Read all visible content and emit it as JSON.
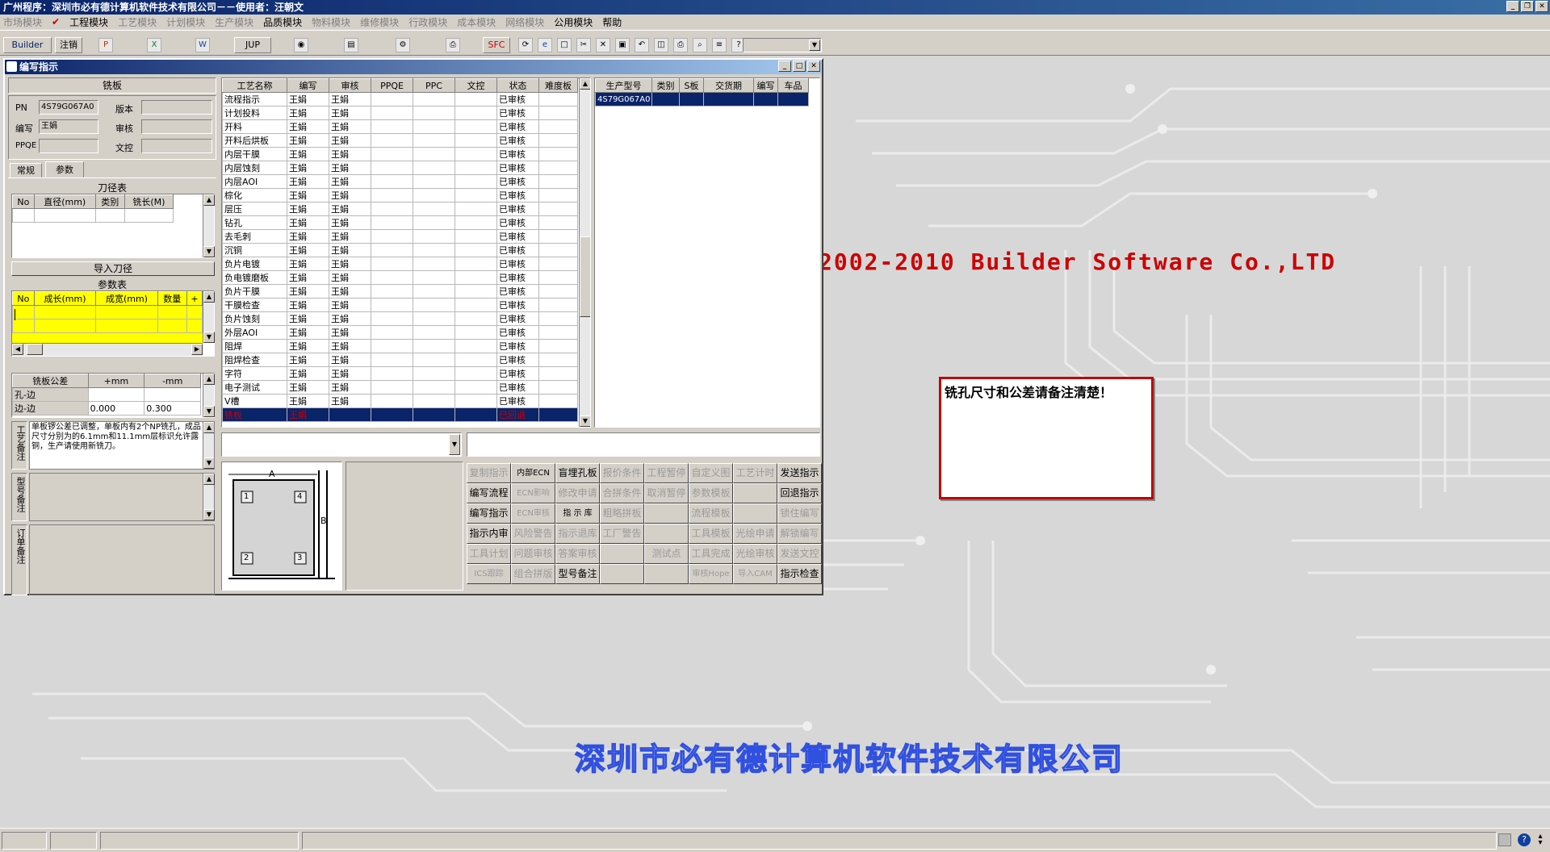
{
  "app": {
    "title": "广州程序：深圳市必有德计算机软件技术有限公司－－使用者：汪朝文"
  },
  "menu": [
    {
      "label": "市场模块",
      "on": false
    },
    {
      "label": "工程模块",
      "on": true
    },
    {
      "label": "工艺模块",
      "on": false
    },
    {
      "label": "计划模块",
      "on": false
    },
    {
      "label": "生产模块",
      "on": false
    },
    {
      "label": "品质模块",
      "on": true
    },
    {
      "label": "物料模块",
      "on": false
    },
    {
      "label": "维修模块",
      "on": false
    },
    {
      "label": "行政模块",
      "on": false
    },
    {
      "label": "成本模块",
      "on": false
    },
    {
      "label": "网络模块",
      "on": false
    },
    {
      "label": "公用模块",
      "on": true
    },
    {
      "label": "帮助",
      "on": true
    }
  ],
  "toolbar": {
    "builder": "Builder",
    "logout": "注销",
    "jup": "JUP",
    "spc": "SFC"
  },
  "window": {
    "title": "编写指示"
  },
  "form": {
    "header": "铣板",
    "pn_label": "PN",
    "pn_value": "4S79G067A0",
    "version_label": "版本",
    "version_value": "",
    "writer_label": "编写",
    "writer_value": "王娟",
    "audit_label": "审核",
    "audit_value": "",
    "ppqe_label": "PPQE",
    "ppqe_value": "",
    "wenkong_label": "文控",
    "wenkong_value": ""
  },
  "tabs": {
    "general": "常规",
    "params": "参数"
  },
  "tool_table": {
    "title": "刀径表",
    "headers": [
      "No",
      "直径(mm)",
      "类别",
      "铣长(M)"
    ],
    "import_button": "导入刀径"
  },
  "param_table": {
    "title": "参数表",
    "headers": [
      "No",
      "成长(mm)",
      "成宽(mm)",
      "数量",
      "+"
    ]
  },
  "tolerance": {
    "headers": [
      "铣板公差",
      "+mm",
      "-mm"
    ],
    "rows": [
      {
        "label": "孔-边",
        "plus": "",
        "minus": ""
      },
      {
        "label": "边-边",
        "plus": "0.000",
        "minus": "0.300"
      }
    ]
  },
  "notes": {
    "process_label": "工艺备注",
    "process_text": "单板锣公差已调整，单板内有2个NP铣孔，成品尺寸分别为的6.1mm和11.1mm层标识允许露铜，生产请使用新铣刀。",
    "model_label": "型号备注",
    "order_label": "订单备注"
  },
  "process_table": {
    "headers": [
      "工艺名称",
      "编写",
      "审核",
      "PPQE",
      "PPC",
      "文控",
      "状态",
      "难度板"
    ],
    "rows": [
      {
        "name": "流程指示",
        "writer": "王娟",
        "audit": "王娟",
        "status": "已审核"
      },
      {
        "name": "计划投料",
        "writer": "王娟",
        "audit": "王娟",
        "status": "已审核"
      },
      {
        "name": "开料",
        "writer": "王娟",
        "audit": "王娟",
        "status": "已审核"
      },
      {
        "name": "开料后烘板",
        "writer": "王娟",
        "audit": "王娟",
        "status": "已审核"
      },
      {
        "name": "内层干膜",
        "writer": "王娟",
        "audit": "王娟",
        "status": "已审核"
      },
      {
        "name": "内层蚀刻",
        "writer": "王娟",
        "audit": "王娟",
        "status": "已审核"
      },
      {
        "name": "内层AOI",
        "writer": "王娟",
        "audit": "王娟",
        "status": "已审核"
      },
      {
        "name": "棕化",
        "writer": "王娟",
        "audit": "王娟",
        "status": "已审核"
      },
      {
        "name": "层压",
        "writer": "王娟",
        "audit": "王娟",
        "status": "已审核"
      },
      {
        "name": "钻孔",
        "writer": "王娟",
        "audit": "王娟",
        "status": "已审核"
      },
      {
        "name": "去毛刺",
        "writer": "王娟",
        "audit": "王娟",
        "status": "已审核"
      },
      {
        "name": "沉铜",
        "writer": "王娟",
        "audit": "王娟",
        "status": "已审核"
      },
      {
        "name": "负片电镀",
        "writer": "王娟",
        "audit": "王娟",
        "status": "已审核"
      },
      {
        "name": "负电镀磨板",
        "writer": "王娟",
        "audit": "王娟",
        "status": "已审核"
      },
      {
        "name": "负片干膜",
        "writer": "王娟",
        "audit": "王娟",
        "status": "已审核"
      },
      {
        "name": "干膜检查",
        "writer": "王娟",
        "audit": "王娟",
        "status": "已审核"
      },
      {
        "name": "负片蚀刻",
        "writer": "王娟",
        "audit": "王娟",
        "status": "已审核"
      },
      {
        "name": "外层AOI",
        "writer": "王娟",
        "audit": "王娟",
        "status": "已审核"
      },
      {
        "name": "阻焊",
        "writer": "王娟",
        "audit": "王娟",
        "status": "已审核"
      },
      {
        "name": "阻焊检查",
        "writer": "王娟",
        "audit": "王娟",
        "status": "已审核"
      },
      {
        "name": "字符",
        "writer": "王娟",
        "audit": "王娟",
        "status": "已审核"
      },
      {
        "name": "电子测试",
        "writer": "王娟",
        "audit": "王娟",
        "status": "已审核"
      },
      {
        "name": "V槽",
        "writer": "王娟",
        "audit": "王娟",
        "status": "已审核"
      },
      {
        "name": "铣板",
        "writer": "王娟",
        "audit": "",
        "status": "已回退"
      }
    ]
  },
  "product_table": {
    "headers": [
      "生产型号",
      "类别",
      "S板",
      "交货期",
      "编写",
      "车品"
    ],
    "rows": [
      {
        "model": "4S79G067A0"
      }
    ]
  },
  "diagram": {
    "a": "A",
    "b": "B",
    "n1": "1",
    "n2": "2",
    "n3": "3",
    "n4": "4"
  },
  "buttons": [
    {
      "label": "复制指示",
      "on": false
    },
    {
      "label": "内部ECN",
      "on": true
    },
    {
      "label": "盲埋孔板",
      "on": true
    },
    {
      "label": "报价条件",
      "on": false
    },
    {
      "label": "工程暂停",
      "on": false
    },
    {
      "label": "自定义图",
      "on": false
    },
    {
      "label": "工艺计时",
      "on": false
    },
    {
      "label": "发送指示",
      "on": true
    },
    {
      "label": "编写流程",
      "on": true
    },
    {
      "label": "ECN影响",
      "on": false
    },
    {
      "label": "修改申请",
      "on": false
    },
    {
      "label": "合拼条件",
      "on": false
    },
    {
      "label": "取消暂停",
      "on": false
    },
    {
      "label": "参数模板",
      "on": false
    },
    {
      "label": "",
      "on": false
    },
    {
      "label": "回退指示",
      "on": true
    },
    {
      "label": "编写指示",
      "on": true
    },
    {
      "label": "ECN审核",
      "on": false
    },
    {
      "label": "指 示 库",
      "on": true
    },
    {
      "label": "粗略拼板",
      "on": false
    },
    {
      "label": "",
      "on": false
    },
    {
      "label": "流程模板",
      "on": false
    },
    {
      "label": "",
      "on": false
    },
    {
      "label": "锁住编写",
      "on": false
    },
    {
      "label": "指示内审",
      "on": true
    },
    {
      "label": "风险警告",
      "on": false
    },
    {
      "label": "指示退库",
      "on": false
    },
    {
      "label": "工厂警告",
      "on": false
    },
    {
      "label": "",
      "on": false
    },
    {
      "label": "工具模板",
      "on": false
    },
    {
      "label": "光绘申请",
      "on": false
    },
    {
      "label": "解锁编写",
      "on": false
    },
    {
      "label": "工具计划",
      "on": false
    },
    {
      "label": "问题审核",
      "on": false
    },
    {
      "label": "答案审核",
      "on": false
    },
    {
      "label": "",
      "on": false
    },
    {
      "label": "测试点",
      "on": false
    },
    {
      "label": "工具完成",
      "on": false
    },
    {
      "label": "光绘审核",
      "on": false
    },
    {
      "label": "发送文控",
      "on": false
    },
    {
      "label": "ICS跟踪",
      "on": false
    },
    {
      "label": "组合拼版",
      "on": false
    },
    {
      "label": "型号备注",
      "on": true
    },
    {
      "label": "",
      "on": false
    },
    {
      "label": "",
      "on": false
    },
    {
      "label": "审核Hope",
      "on": false
    },
    {
      "label": "导入CAM",
      "on": false
    },
    {
      "label": "指示检查",
      "on": true
    }
  ],
  "note_popup": {
    "text": "铣孔尺寸和公差请备注清楚！"
  },
  "desktop": {
    "copyright": "2002-2010 Builder Software Co.,LTD",
    "company": "深圳市必有德计算机软件技术有限公司"
  },
  "colors": {
    "title_blue": "#0a246a",
    "selection": "#0a246a",
    "yellow": "#ffff00",
    "red": "#cc0000",
    "blue_text": "#3050e0"
  }
}
